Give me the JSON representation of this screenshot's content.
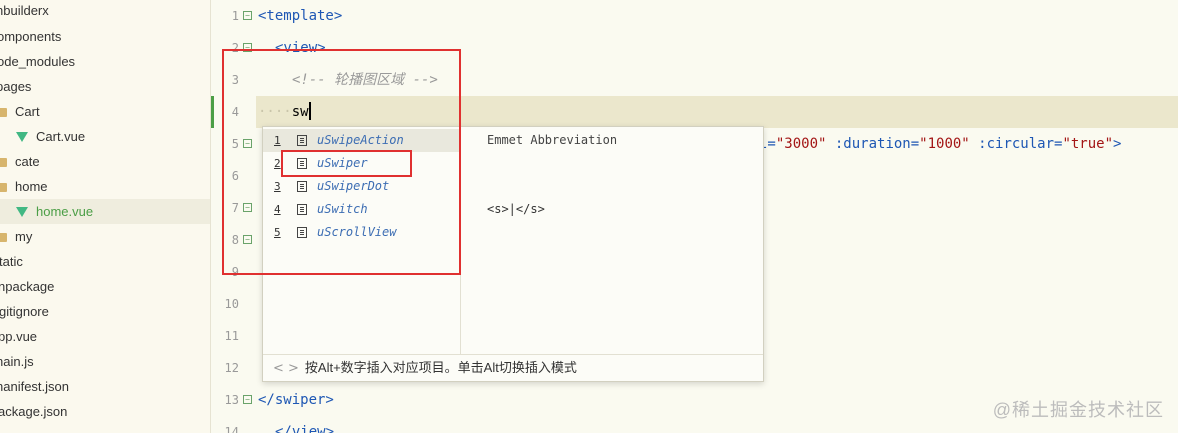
{
  "sidebar": {
    "items": [
      {
        "label": "nbuilderx",
        "type": "text",
        "active": false
      },
      {
        "label": "omponents",
        "type": "text",
        "active": false
      },
      {
        "label": "ode_modules",
        "type": "text",
        "active": false
      },
      {
        "label": "pages",
        "type": "text",
        "active": false
      },
      {
        "label": "Cart",
        "type": "folder",
        "active": false
      },
      {
        "label": "Cart.vue",
        "type": "vue",
        "active": false
      },
      {
        "label": "cate",
        "type": "folder",
        "active": false
      },
      {
        "label": "home",
        "type": "folder",
        "active": false
      },
      {
        "label": "home.vue",
        "type": "vue",
        "active": true
      },
      {
        "label": "my",
        "type": "folder",
        "active": false
      },
      {
        "label": "tatic",
        "type": "text",
        "active": false
      },
      {
        "label": "npackage",
        "type": "text",
        "active": false
      },
      {
        "label": "gitignore",
        "type": "text",
        "active": false
      },
      {
        "label": "pp.vue",
        "type": "text",
        "active": false
      },
      {
        "label": "nain.js",
        "type": "text",
        "active": false
      },
      {
        "label": "nanifest.json",
        "type": "text",
        "active": false
      },
      {
        "label": "ackage.json",
        "type": "text",
        "active": false
      }
    ]
  },
  "editor": {
    "line_numbers": [
      "1",
      "2",
      "3",
      "4",
      "5",
      "6",
      "7",
      "8",
      "9",
      "10",
      "11",
      "12",
      "13",
      "14"
    ],
    "line1": "<template>",
    "line2": "<view>",
    "line3_comment": "<!-- 轮播图区域 -->",
    "line4_typed": "sw",
    "line4_indent": "····",
    "line5_tail_attr1_name": "l=",
    "line5_tail_attr1_val": "\"3000\"",
    "line5_tail_attr2_name": " :duration=",
    "line5_tail_attr2_val": "\"1000\"",
    "line5_tail_attr3_name": " :circular=",
    "line5_tail_attr3_val": "\"true\"",
    "line5_tail_close": ">",
    "line13": "</swiper>",
    "line14": "</view>"
  },
  "autocomplete": {
    "items": [
      {
        "num": "1",
        "label": "uSwipeAction"
      },
      {
        "num": "2",
        "label": "uSwiper"
      },
      {
        "num": "3",
        "label": "uSwiperDot"
      },
      {
        "num": "4",
        "label": "uSwitch"
      },
      {
        "num": "5",
        "label": "uScrollView"
      }
    ],
    "detail_title": "Emmet Abbreviation",
    "detail_body": "<s>|</s>",
    "footer_arrows": "< >",
    "footer_text": "按Alt+数字插入对应项目。单击Alt切换插入模式"
  },
  "watermark": "@稀土掘金技术社区",
  "colors": {
    "accent_green": "#4b9e46",
    "tag_blue": "#1e57b4",
    "annotation_red": "#e03030"
  }
}
